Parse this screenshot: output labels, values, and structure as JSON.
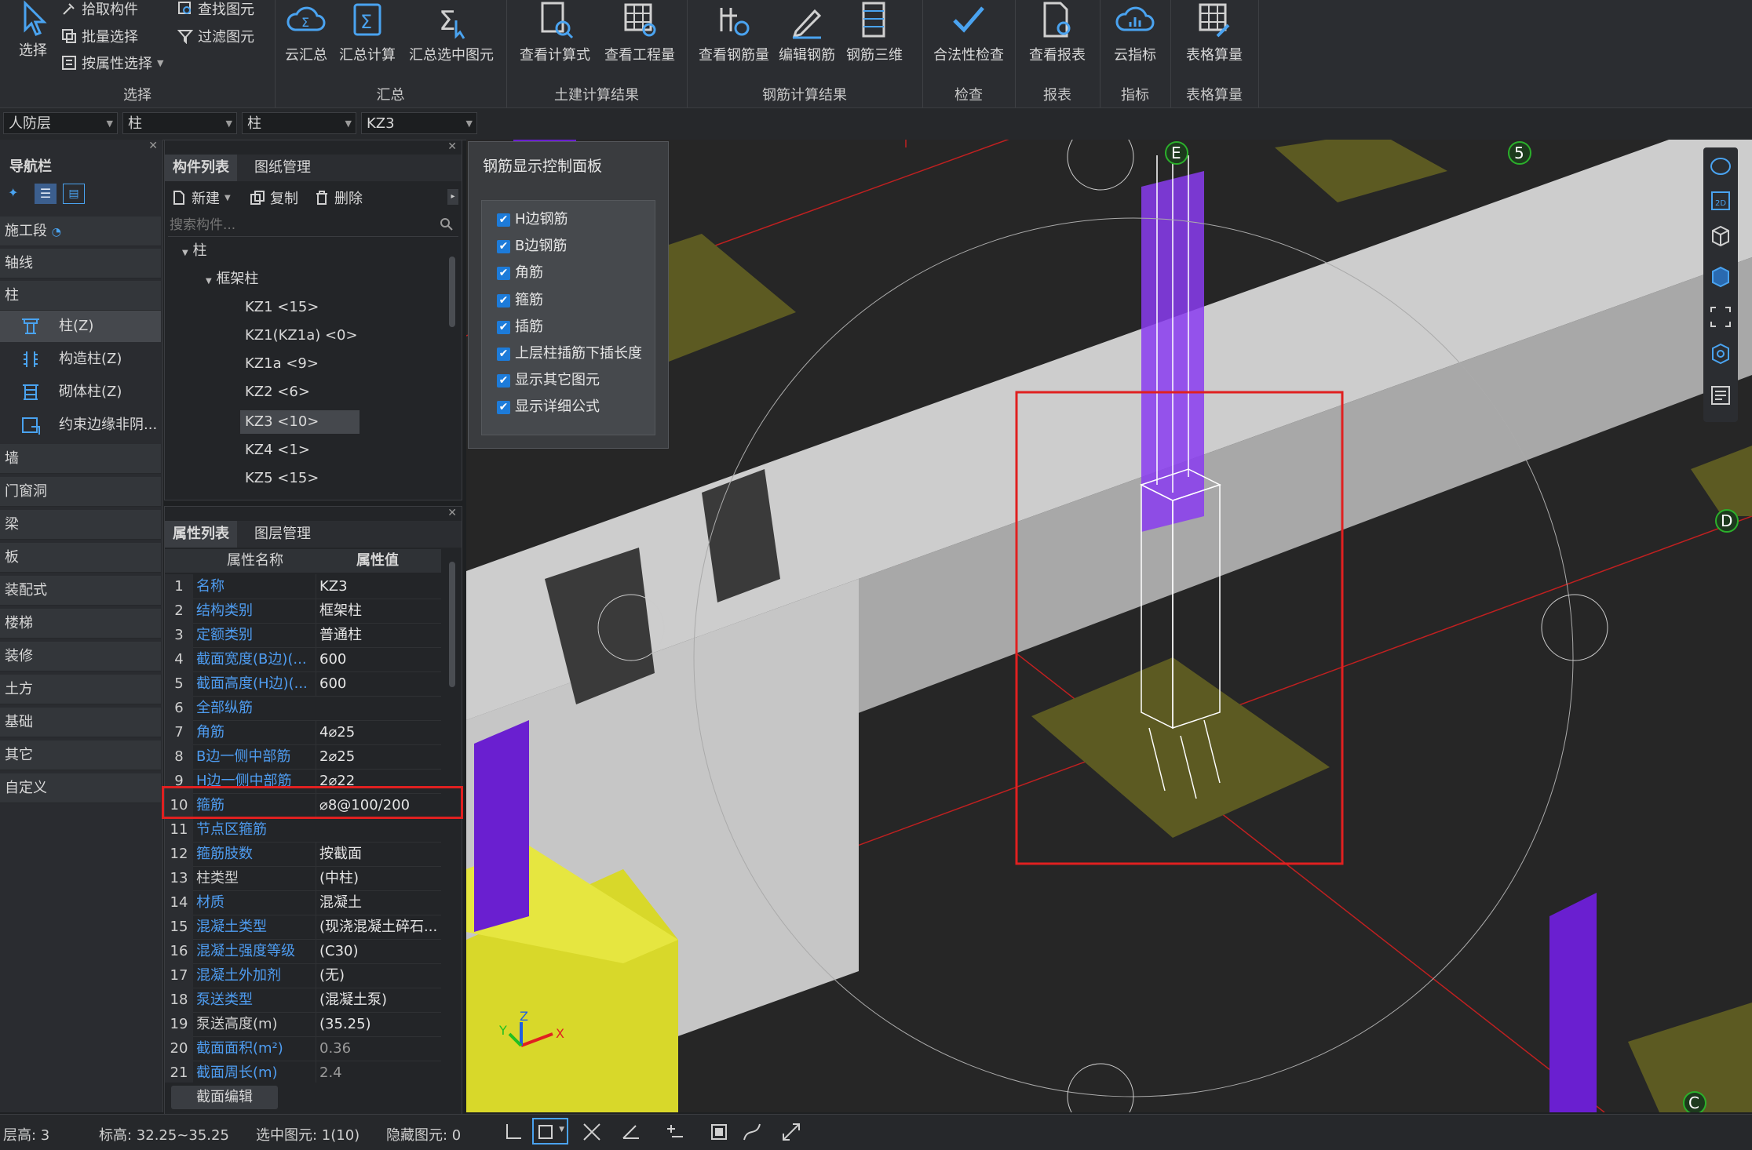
{
  "ribbon": {
    "select_group": {
      "label": "选择",
      "select_button": "选择",
      "pick_component": "拾取构件",
      "batch_select": "批量选择",
      "select_by_property": "按属性选择",
      "find_element": "查找图元",
      "filter_element": "过滤图元"
    },
    "summary_group": {
      "label": "汇总",
      "cloud_summary": "云汇总",
      "summary_calc": "汇总计算",
      "summary_selected": "汇总选中图元"
    },
    "civil_group": {
      "label": "土建计算结果",
      "view_formula": "查看计算式",
      "view_quantity": "查看工程量"
    },
    "rebar_group": {
      "label": "钢筋计算结果",
      "view_rebar_qty": "查看钢筋量",
      "edit_rebar": "编辑钢筋",
      "rebar_3d": "钢筋三维"
    },
    "check_group": {
      "label": "检查",
      "legality_check": "合法性检查"
    },
    "report_group": {
      "label": "报表",
      "view_report": "查看报表"
    },
    "index_group": {
      "label": "指标",
      "cloud_index": "云指标"
    },
    "table_group": {
      "label": "表格算量",
      "table_calc": "表格算量"
    }
  },
  "filter_bar": {
    "floor": "人防层",
    "category": "柱",
    "type": "柱",
    "component": "KZ3"
  },
  "nav": {
    "title": "导航栏",
    "items": [
      {
        "label": "施工段"
      },
      {
        "label": "轴线"
      },
      {
        "label": "柱"
      },
      {
        "label": "墙"
      },
      {
        "label": "门窗洞"
      },
      {
        "label": "梁"
      },
      {
        "label": "板"
      },
      {
        "label": "装配式"
      },
      {
        "label": "楼梯"
      },
      {
        "label": "装修"
      },
      {
        "label": "土方"
      },
      {
        "label": "基础"
      },
      {
        "label": "其它"
      },
      {
        "label": "自定义"
      }
    ],
    "column_subitems": [
      {
        "label": "柱(Z)"
      },
      {
        "label": "构造柱(Z)"
      },
      {
        "label": "砌体柱(Z)"
      },
      {
        "label": "约束边缘非阴..."
      }
    ]
  },
  "component_list": {
    "tab_list": "构件列表",
    "tab_drawings": "图纸管理",
    "new_label": "新建",
    "copy_label": "复制",
    "delete_label": "删除",
    "search_placeholder": "搜索构件...",
    "tree_root": "柱",
    "tree_group": "框架柱",
    "items": [
      {
        "label": "KZ1 <15>"
      },
      {
        "label": "KZ1(KZ1a) <0>"
      },
      {
        "label": "KZ1a <9>"
      },
      {
        "label": "KZ2 <6>"
      },
      {
        "label": "KZ3 <10>"
      },
      {
        "label": "KZ4 <1>"
      },
      {
        "label": "KZ5 <15>"
      }
    ]
  },
  "properties": {
    "tab_props": "属性列表",
    "tab_layers": "图层管理",
    "col_name": "属性名称",
    "col_value": "属性值",
    "rows": [
      {
        "num": "1",
        "name": "名称",
        "value": "KZ3"
      },
      {
        "num": "2",
        "name": "结构类别",
        "value": "框架柱"
      },
      {
        "num": "3",
        "name": "定额类别",
        "value": "普通柱"
      },
      {
        "num": "4",
        "name": "截面宽度(B边)(...",
        "value": "600"
      },
      {
        "num": "5",
        "name": "截面高度(H边)(...",
        "value": "600"
      },
      {
        "num": "6",
        "name": "全部纵筋",
        "value": ""
      },
      {
        "num": "7",
        "name": "角筋",
        "value": "4⌀25"
      },
      {
        "num": "8",
        "name": "B边一侧中部筋",
        "value": "2⌀25"
      },
      {
        "num": "9",
        "name": "H边一侧中部筋",
        "value": "2⌀22"
      },
      {
        "num": "10",
        "name": "箍筋",
        "value": "⌀8@100/200"
      },
      {
        "num": "11",
        "name": "节点区箍筋",
        "value": ""
      },
      {
        "num": "12",
        "name": "箍筋肢数",
        "value": "按截面"
      },
      {
        "num": "13",
        "name": "柱类型",
        "value": "(中柱)"
      },
      {
        "num": "14",
        "name": "材质",
        "value": "混凝土"
      },
      {
        "num": "15",
        "name": "混凝土类型",
        "value": "(现浇混凝土碎石..."
      },
      {
        "num": "16",
        "name": "混凝土强度等级",
        "value": "(C30)"
      },
      {
        "num": "17",
        "name": "混凝土外加剂",
        "value": "(无)"
      },
      {
        "num": "18",
        "name": "泵送类型",
        "value": "(混凝土泵)"
      },
      {
        "num": "19",
        "name": "泵送高度(m)",
        "value": "(35.25)"
      },
      {
        "num": "20",
        "name": "截面面积(m²)",
        "value": "0.36"
      },
      {
        "num": "21",
        "name": "截面周长(m)",
        "value": "2.4"
      }
    ],
    "section_edit": "截面编辑"
  },
  "rebar_panel": {
    "title": "钢筋显示控制面板",
    "options": [
      {
        "label": "H边钢筋",
        "checked": true
      },
      {
        "label": "B边钢筋",
        "checked": true
      },
      {
        "label": "角筋",
        "checked": true
      },
      {
        "label": "箍筋",
        "checked": true
      },
      {
        "label": "插筋",
        "checked": true
      },
      {
        "label": "上层柱插筋下插长度",
        "checked": true
      },
      {
        "label": "显示其它图元",
        "checked": true
      },
      {
        "label": "显示详细公式",
        "checked": true
      }
    ]
  },
  "viewport": {
    "axis_labels": {
      "e": "E",
      "five": "5",
      "d": "D",
      "c": "C"
    },
    "gizmo": {
      "x": "X",
      "y": "Y",
      "z": "Z"
    },
    "colors": {
      "column": "#6a1fd0",
      "beam": "#cfcfcf",
      "footing": "#5c5a22",
      "wall": "#d8d82a",
      "highlight": "#e02020"
    }
  },
  "status": {
    "floor_height": "层高:  3",
    "elevation": "标高:  32.25~35.25",
    "selected": "选中图元:  1(10)",
    "hidden": "隐藏图元:  0"
  }
}
